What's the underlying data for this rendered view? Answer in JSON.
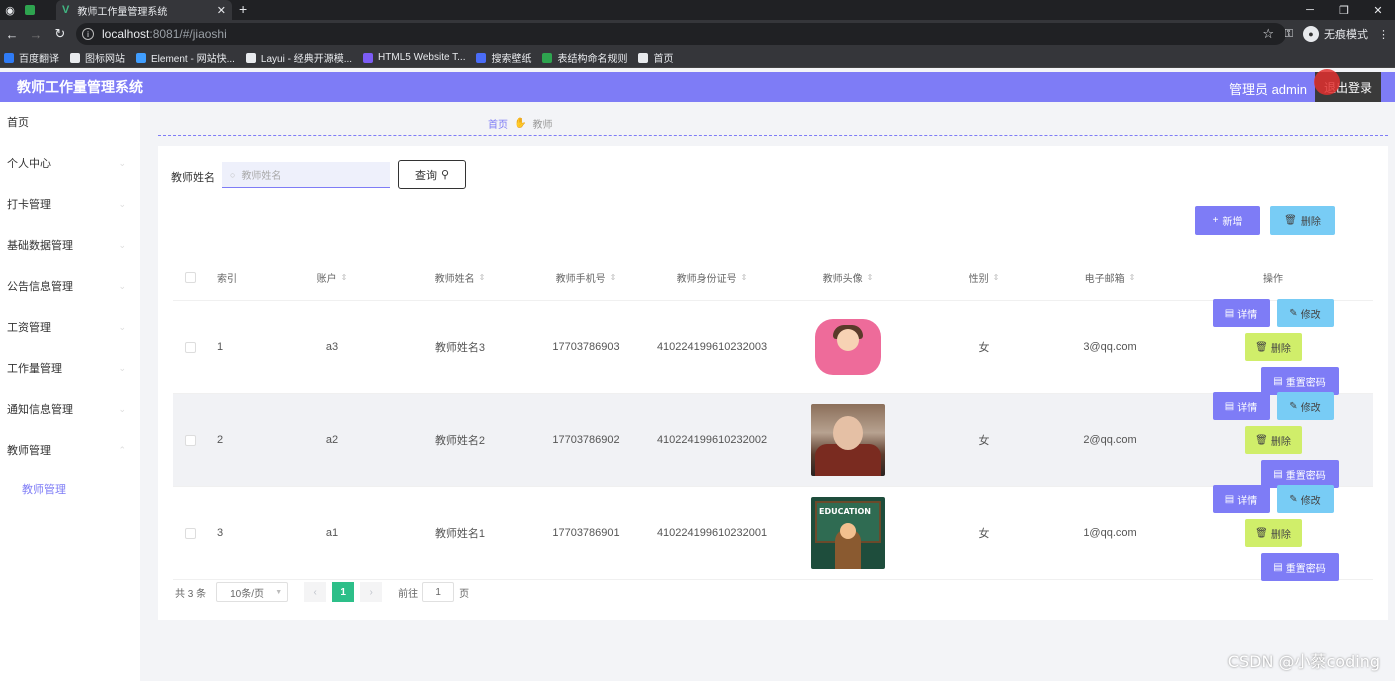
{
  "browser": {
    "tab_title": "教师工作量管理系统",
    "url_host": "localhost",
    "url_path": ":8081/#/jiaoshi",
    "incognito_label": "无痕模式",
    "bookmarks": [
      {
        "label": "百度翻译",
        "color": "#2f7bf5"
      },
      {
        "label": "图标网站",
        "color": "#e8eaed"
      },
      {
        "label": "Element - 网站快...",
        "color": "#409eff"
      },
      {
        "label": "Layui - 经典开源模...",
        "color": "#e8eaed"
      },
      {
        "label": "HTML5 Website T...",
        "color": "#7c5cf5"
      },
      {
        "label": "搜索壁纸",
        "color": "#4a6cf7"
      },
      {
        "label": "表结构命名规则",
        "color": "#2ea44f"
      },
      {
        "label": "首页",
        "color": "#e8eaed"
      }
    ]
  },
  "header": {
    "title": "教师工作量管理系统",
    "user": "管理员 admin",
    "logout": "退出登录"
  },
  "sidebar": {
    "items": [
      {
        "label": "首页",
        "arrow": false
      },
      {
        "label": "个人中心",
        "arrow": true
      },
      {
        "label": "打卡管理",
        "arrow": true
      },
      {
        "label": "基础数据管理",
        "arrow": true
      },
      {
        "label": "公告信息管理",
        "arrow": true
      },
      {
        "label": "工资管理",
        "arrow": true
      },
      {
        "label": "工作量管理",
        "arrow": true
      },
      {
        "label": "通知信息管理",
        "arrow": true
      },
      {
        "label": "教师管理",
        "arrow": true
      }
    ],
    "sub_item": "教师管理"
  },
  "breadcrumb": {
    "home": "首页",
    "current": "教师"
  },
  "search": {
    "label": "教师姓名",
    "placeholder": "教师姓名",
    "button": "查询"
  },
  "actions": {
    "add": "新增",
    "delete": "删除"
  },
  "table": {
    "columns": [
      "索引",
      "账户",
      "教师姓名",
      "教师手机号",
      "教师身份证号",
      "教师头像",
      "性别",
      "电子邮箱",
      "操作"
    ],
    "rows": [
      {
        "index": "1",
        "account": "a3",
        "name": "教师姓名3",
        "phone": "17703786903",
        "id_card": "410224199610232003",
        "gender": "女",
        "email": "3@qq.com"
      },
      {
        "index": "2",
        "account": "a2",
        "name": "教师姓名2",
        "phone": "17703786902",
        "id_card": "410224199610232002",
        "gender": "女",
        "email": "2@qq.com"
      },
      {
        "index": "3",
        "account": "a1",
        "name": "教师姓名1",
        "phone": "17703786901",
        "id_card": "410224199610232001",
        "gender": "女",
        "email": "1@qq.com"
      }
    ],
    "ops": {
      "detail": "详情",
      "edit": "修改",
      "delete": "删除",
      "reset": "重置密码"
    }
  },
  "pager": {
    "total": "共 3 条",
    "page_size": "10条/页",
    "current_page": "1",
    "goto_label": "前往",
    "goto_value": "1",
    "page_unit": "页"
  },
  "avatar3_text": "EDUCATION",
  "watermark": "CSDN @小蔡coding"
}
